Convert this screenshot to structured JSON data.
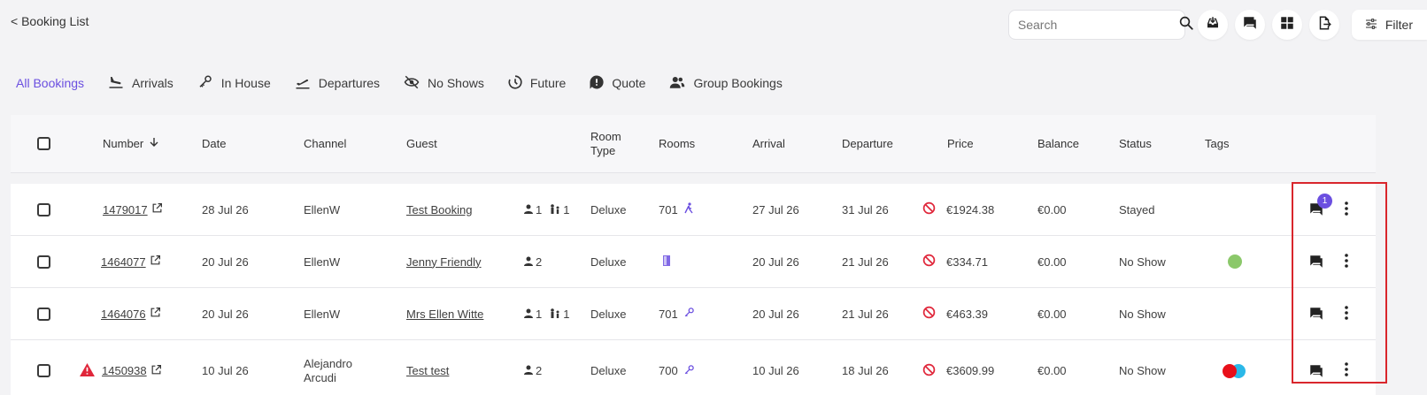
{
  "header": {
    "back_label": "< Booking List"
  },
  "toolbar": {
    "search_placeholder": "Search",
    "filter_label": "Filter"
  },
  "tabs": [
    {
      "label": "All Bookings",
      "icon": "list"
    },
    {
      "label": "Arrivals",
      "icon": "plane-landing-icon"
    },
    {
      "label": "In House",
      "icon": "key-icon"
    },
    {
      "label": "Departures",
      "icon": "plane-takeoff-icon"
    },
    {
      "label": "No Shows",
      "icon": "eye-off-icon"
    },
    {
      "label": "Future",
      "icon": "clock-icon"
    },
    {
      "label": "Quote",
      "icon": "quote-icon"
    },
    {
      "label": "Group Bookings",
      "icon": "group-icon"
    }
  ],
  "columns": {
    "number": "Number",
    "date": "Date",
    "channel": "Channel",
    "guest": "Guest",
    "room_type_1": "Room",
    "room_type_2": "Type",
    "rooms": "Rooms",
    "arrival": "Arrival",
    "departure": "Departure",
    "price": "Price",
    "balance": "Balance",
    "status": "Status",
    "tags": "Tags"
  },
  "rows": [
    {
      "number": "1479017",
      "date": "28 Jul 26",
      "channel": "EllenW",
      "guest": "Test Booking",
      "adults": "1",
      "children": "1",
      "room_type": "Deluxe",
      "room": "701",
      "arrival": "27 Jul 26",
      "departure": "31 Jul 26",
      "price": "€1924.38",
      "balance": "€0.00",
      "status": "Stayed",
      "unread": "1"
    },
    {
      "number": "1464077",
      "date": "20 Jul 26",
      "channel": "EllenW",
      "guest": "Jenny Friendly",
      "adults": "2",
      "room_type": "Deluxe",
      "room": "",
      "arrival": "20 Jul 26",
      "departure": "21 Jul 26",
      "price": "€334.71",
      "balance": "€0.00",
      "status": "No Show",
      "tag_colors": [
        "#8bc86a"
      ]
    },
    {
      "number": "1464076",
      "date": "20 Jul 26",
      "channel": "EllenW",
      "guest": "Mrs Ellen Witte",
      "adults": "1",
      "children": "1",
      "room_type": "Deluxe",
      "room": "701",
      "arrival": "20 Jul 26",
      "departure": "21 Jul 26",
      "price": "€463.39",
      "balance": "€0.00",
      "status": "No Show"
    },
    {
      "number": "1450938",
      "date": "10 Jul 26",
      "channel_1": "Alejandro",
      "channel_2": "Arcudi",
      "guest": "Test test",
      "adults": "2",
      "room_type": "Deluxe",
      "room": "700",
      "arrival": "10 Jul 26",
      "departure": "18 Jul 26",
      "price": "€3609.99",
      "balance": "€0.00",
      "status": "No Show",
      "tag_colors": [
        "#e8101a",
        "#2bb8e8"
      ]
    }
  ],
  "colors": {
    "accent": "#6b4fe0",
    "alert": "#e0263a",
    "no_refund": "#e0263a"
  }
}
